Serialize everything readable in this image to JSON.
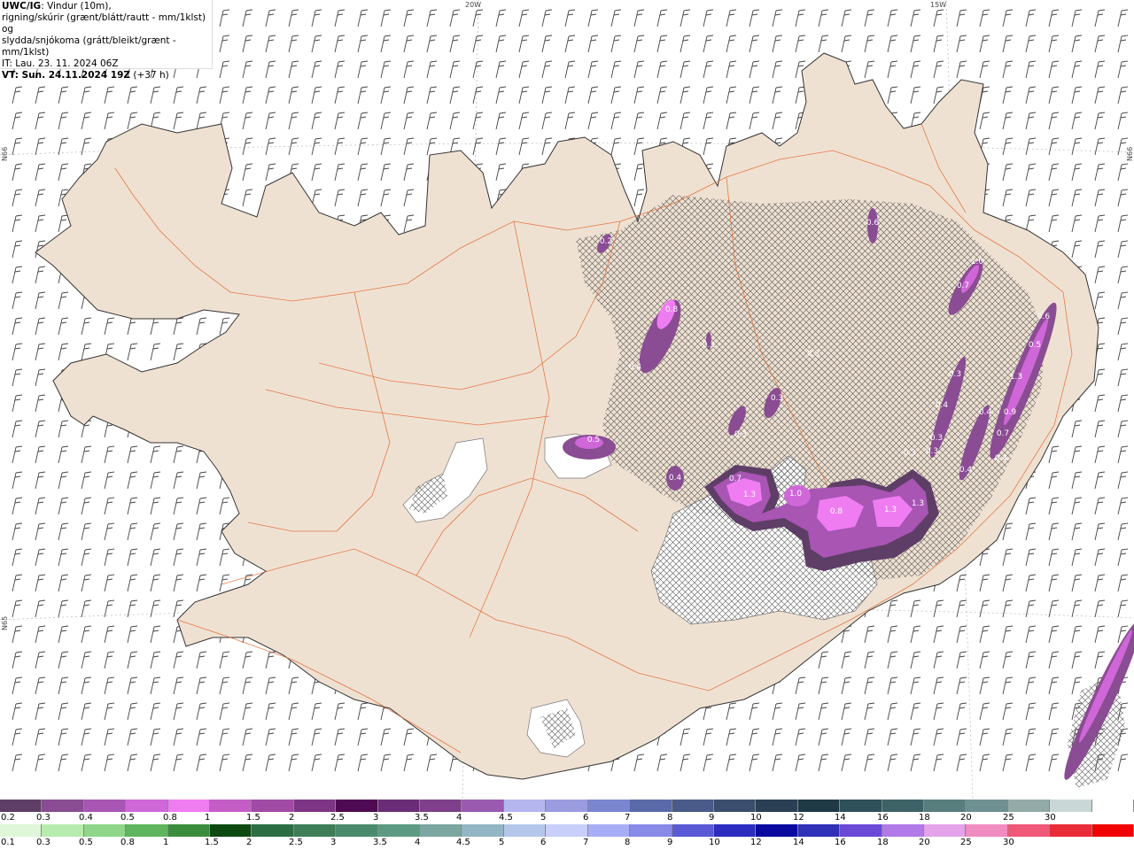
{
  "header": {
    "model": "UWC/IG",
    "line1_rest": ": Vindur (10m),",
    "line2": "rigning/skúrir (grænt/blátt/rautt - mm/1klst) og",
    "line3": "slydda/snjókoma (grátt/bleikt/grænt - mm/1klst)",
    "it": "IT: Lau. 23. 11. 2024 06Z",
    "vt_bold": "VT: Sun. 24.11.2024 19Z",
    "vt_rest": " (+37 h)"
  },
  "grid_labels": {
    "top_20w": "20W",
    "top_15w": "15W",
    "left_66n": "N66",
    "right_66n": "N66",
    "left_65n": "N65"
  },
  "map_labels": [
    {
      "text": "0.2"
    },
    {
      "text": "0.8"
    },
    {
      "text": "0.4"
    },
    {
      "text": "0.5"
    },
    {
      "text": "0.4"
    },
    {
      "text": "0.6"
    },
    {
      "text": "1.0"
    },
    {
      "text": "0.7"
    },
    {
      "text": "0.6"
    },
    {
      "text": "0.5"
    },
    {
      "text": "1.3"
    },
    {
      "text": "0.9"
    },
    {
      "text": "0.7"
    },
    {
      "text": "0.4"
    },
    {
      "text": "0.3"
    },
    {
      "text": "0.4"
    },
    {
      "text": "0.4"
    },
    {
      "text": "0.3"
    },
    {
      "text": "0.3"
    },
    {
      "text": "0.3"
    },
    {
      "text": "0.3"
    },
    {
      "text": "0.3"
    },
    {
      "text": "0.7"
    },
    {
      "text": "1.3"
    },
    {
      "text": "1.0"
    },
    {
      "text": "0.8"
    },
    {
      "text": "1.3"
    },
    {
      "text": "1.3"
    },
    {
      "text": "0.4"
    },
    {
      "text": "0.3"
    },
    {
      "text": "0.3"
    }
  ],
  "snow_scale": {
    "labels": [
      "0.2",
      "0.3",
      "0.4",
      "0.5",
      "0.8",
      "1",
      "1.5",
      "2",
      "2.5",
      "3",
      "3.5",
      "4",
      "4.5",
      "5",
      "6",
      "7",
      "8",
      "9",
      "10",
      "12",
      "14",
      "16",
      "18",
      "20",
      "25",
      "30"
    ],
    "colors": [
      "#5e3e66",
      "#8a4c93",
      "#a855b4",
      "#d067d8",
      "#f07cf2",
      "#c45ec6",
      "#a14aa6",
      "#7e3585",
      "#4e0a52",
      "#6b2d78",
      "#7f3f8a",
      "#9a5ab0",
      "#b5b5ef",
      "#9b9be0",
      "#7a86d0",
      "#5a6aa8",
      "#4a5b8a",
      "#3b4e6e",
      "#2b3f55",
      "#1f3a44",
      "#2e5059",
      "#3d6366",
      "#587d7d",
      "#6f9090",
      "#93aaa8",
      "#c9d8d6",
      "#ffffff"
    ]
  },
  "rain_scale": {
    "labels": [
      "0.1",
      "0.3",
      "0.5",
      "0.8",
      "1",
      "1.5",
      "2",
      "2.5",
      "3",
      "3.5",
      "4",
      "4.5",
      "5",
      "6",
      "7",
      "8",
      "9",
      "10",
      "12",
      "14",
      "16",
      "18",
      "20",
      "25",
      "30"
    ],
    "colors": [
      "#dff7d8",
      "#b8ecae",
      "#8fd68a",
      "#5fb55d",
      "#3b8d3e",
      "#0d4a12",
      "#2c6e44",
      "#3d7d58",
      "#4b8b6d",
      "#5d9a83",
      "#7ba7a0",
      "#93b5c4",
      "#b4c7ea",
      "#c9cffb",
      "#a8aef5",
      "#8989e8",
      "#5a5ad6",
      "#2c2cc0",
      "#0a0aa0",
      "#3030b8",
      "#6a4ad6",
      "#b07ae8",
      "#e4a3ea",
      "#f08cc0",
      "#f0587a",
      "#e82c38",
      "#f00000"
    ]
  },
  "wind_barb": {
    "icon": "wind-barb-icon",
    "angle_deg": 15
  }
}
